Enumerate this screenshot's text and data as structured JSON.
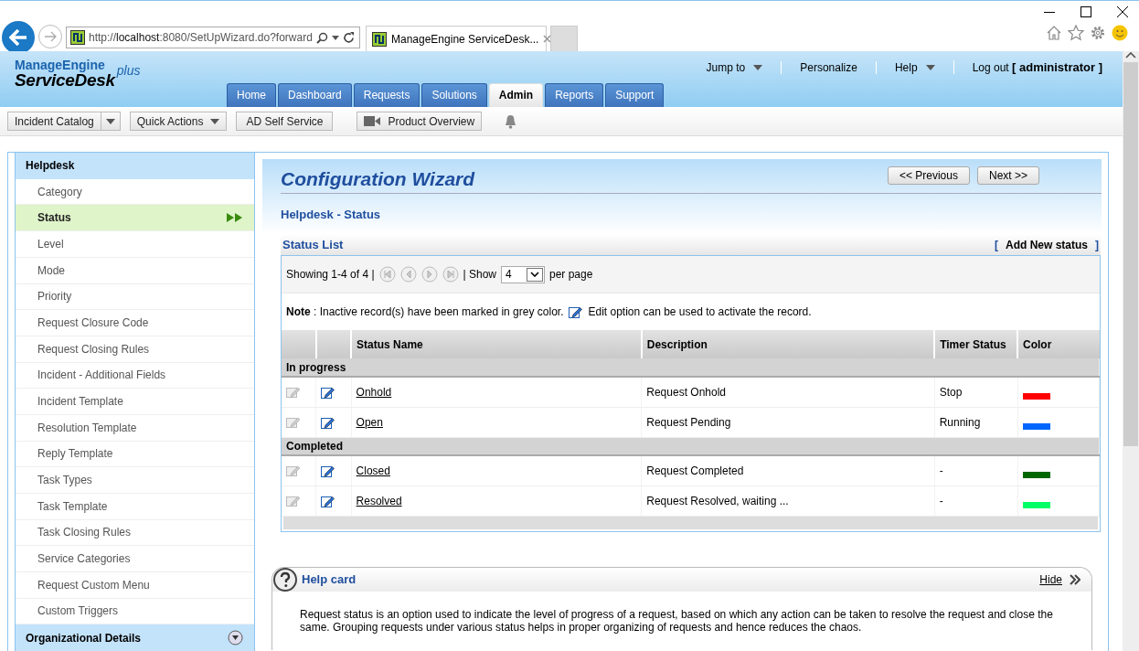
{
  "browser": {
    "address": "http://**localhost**:8080/SetUpWizard.do?forward",
    "tab_title": "ManageEngine ServiceDesk..."
  },
  "header": {
    "logo": {
      "brand": "ManageEngine",
      "product": "ServiceDesk",
      "edition": "plus"
    },
    "top_links": [
      {
        "label": "Jump to",
        "dropdown": true
      },
      {
        "label": "Personalize",
        "dropdown": false
      },
      {
        "label": "Help",
        "dropdown": true
      }
    ],
    "logout": {
      "label": "Log out",
      "user": "[ administrator ]"
    },
    "nav_tabs": [
      {
        "label": "Home",
        "selected": false
      },
      {
        "label": "Dashboard",
        "selected": false
      },
      {
        "label": "Requests",
        "selected": false
      },
      {
        "label": "Solutions",
        "selected": false
      },
      {
        "label": "Admin",
        "selected": true
      },
      {
        "label": "Reports",
        "selected": false
      },
      {
        "label": "Support",
        "selected": false
      }
    ]
  },
  "toolbar": [
    {
      "label": "Incident Catalog",
      "kind": "split"
    },
    {
      "label": "Quick Actions",
      "kind": "dropdown"
    },
    {
      "label": "AD Self Service",
      "kind": "plain"
    },
    {
      "label": "Product Overview",
      "kind": "video"
    }
  ],
  "sidebar": [
    {
      "title": "Helpdesk",
      "expanded": true,
      "items": [
        {
          "label": "Category",
          "selected": false
        },
        {
          "label": "Status",
          "selected": true
        },
        {
          "label": "Level",
          "selected": false
        },
        {
          "label": "Mode",
          "selected": false
        },
        {
          "label": "Priority",
          "selected": false
        },
        {
          "label": "Request Closure Code",
          "selected": false
        },
        {
          "label": "Request Closing Rules",
          "selected": false
        },
        {
          "label": "Incident - Additional Fields",
          "selected": false
        },
        {
          "label": "Incident Template",
          "selected": false
        },
        {
          "label": "Resolution Template",
          "selected": false
        },
        {
          "label": "Reply Template",
          "selected": false
        },
        {
          "label": "Task Types",
          "selected": false
        },
        {
          "label": "Task Template",
          "selected": false
        },
        {
          "label": "Task Closing Rules",
          "selected": false
        },
        {
          "label": "Service Categories",
          "selected": false
        },
        {
          "label": "Request Custom Menu",
          "selected": false
        },
        {
          "label": "Custom Triggers",
          "selected": false
        }
      ]
    },
    {
      "title": "Organizational Details",
      "expanded": false
    }
  ],
  "wizard": {
    "title": "Configuration Wizard",
    "buttons": [
      "<< Previous",
      "Next >>"
    ],
    "subtitle": "Helpdesk - Status"
  },
  "status_list": {
    "title": "Status List",
    "add_link": {
      "open": "[",
      "label": "Add New status",
      "close": "]"
    },
    "pagination": {
      "summary": "Showing 1-4 of 4 |",
      "show": "| Show",
      "per_page": "4",
      "suffix": "per page"
    },
    "note": "**Note** : Inactive record(s) have been marked in grey color.",
    "note_tail": "Edit option can be used to activate the record.",
    "columns": [
      "Status Name",
      "Description",
      "Timer Status",
      "Color"
    ],
    "groups": [
      {
        "title": "In progress",
        "rows": [
          {
            "name": "Onhold",
            "description": "Request Onhold",
            "timer": "Stop",
            "color": "#ff0000"
          },
          {
            "name": "Open",
            "description": "Request Pending",
            "timer": "Running",
            "color": "#0066ff"
          }
        ]
      },
      {
        "title": "Completed",
        "rows": [
          {
            "name": "Closed",
            "description": "Request Completed",
            "timer": "-",
            "color": "#006600"
          },
          {
            "name": "Resolved",
            "description": "Request Resolved, waiting ...",
            "timer": "-",
            "color": "#00ff66"
          }
        ]
      }
    ]
  },
  "help_card": {
    "title": "Help card",
    "hide": "Hide",
    "text": "Request status is an option used to indicate the level of progress of a request, based on which any action can be taken to resolve the request and close the same. Grouping requests under various status helps in proper organizing of requests and hence reduces the chaos."
  }
}
